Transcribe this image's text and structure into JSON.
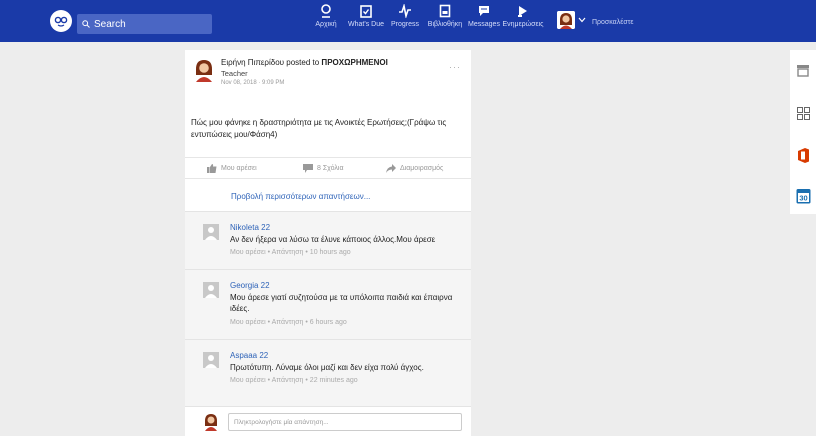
{
  "topbar": {
    "search_placeholder": "Search",
    "nav": [
      {
        "label": "Αρχική",
        "icon": "home-icon"
      },
      {
        "label": "What's Due",
        "icon": "calendar-check-icon"
      },
      {
        "label": "Progress",
        "icon": "pulse-icon"
      },
      {
        "label": "Βιβλιοθήκη",
        "icon": "library-icon"
      },
      {
        "label": "Messages",
        "icon": "chat-icon"
      },
      {
        "label": "Ενημερώσεις",
        "icon": "megaphone-icon"
      }
    ],
    "invite_label": "Προσκαλέστε"
  },
  "post": {
    "author": "Ειρήνη Πιπερίδου",
    "posted_to_text": "posted to",
    "group": "ΠΡΟΧΩΡΗΜΕΝΟΙ",
    "role": "Teacher",
    "date": "Nov 08, 2018 · 9:09 PM",
    "more": "···",
    "body": "Πώς μου φάνηκε η δραστηριότητα με τις Ανοικτές Ερωτήσεις;(Γράψω τις εντυπώσεις μου/Φάση4)"
  },
  "actions": {
    "like": "Μου αρέσει",
    "comments": "8 Σχόλια",
    "share": "Διαμοιρασμός"
  },
  "more_replies": "Προβολή περισσότερων απαντήσεων...",
  "comments": [
    {
      "name": "Nikoleta 22",
      "text": "Αν δεν ήξερα να λύσω τα έλυνε κάποιος άλλος.Μου άρεσε",
      "like": "Μου αρέσει",
      "reply": "Απάντηση",
      "time": "10 hours ago"
    },
    {
      "name": "Georgia 22",
      "text": "Μου άρεσε γιατί συζητούσα με τα υπόλοιπα παιδιά και έπαιρνα ιδέες.",
      "like": "Μου αρέσει",
      "reply": "Απάντηση",
      "time": "6 hours ago"
    },
    {
      "name": "Aspaaa 22",
      "text": "Πρωτότυπη. Λύναμε όλοι μαζί και δεν είχα πολύ άγχος.",
      "like": "Μου αρέσει",
      "reply": "Απάντηση",
      "time": "22 minutes ago"
    }
  ],
  "reply_placeholder": "Πληκτρολογήστε μία απάντηση...",
  "side_panel": {
    "calendar_day": "30"
  },
  "colors": {
    "topbar": "#1a3aa8",
    "link": "#2e63b8",
    "office": "#d83b01",
    "calendar": "#1a6fb0"
  }
}
